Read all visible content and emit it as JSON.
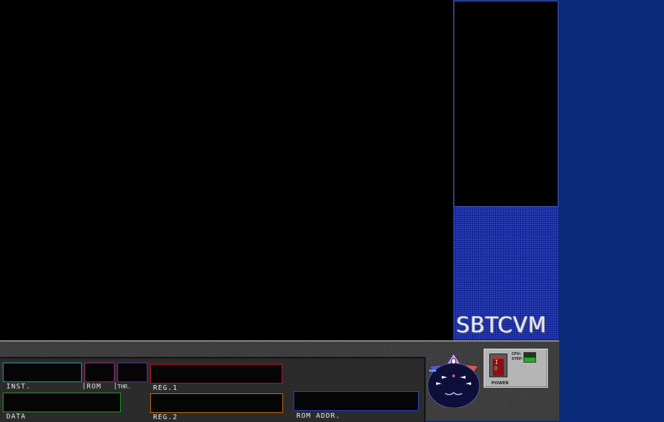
{
  "side_panel": {
    "logo": "SBTCVM"
  },
  "registers": {
    "inst": {
      "label": "INST.",
      "color": "#19a5b3"
    },
    "rom": {
      "label": "ROM",
      "color": "#b01e8c"
    },
    "thr": {
      "label": "THR.",
      "color": "#6a2aa8"
    },
    "reg1": {
      "label": "REG.1",
      "color": "#b8142a"
    },
    "data": {
      "label": "DATA",
      "color": "#1aa51a"
    },
    "reg2": {
      "label": "REG.2",
      "color": "#c8700a"
    },
    "rom_addr": {
      "label": "ROM ADDR.",
      "color": "#2a40c8"
    }
  },
  "power_box": {
    "cpu_label": "CPU:",
    "step_label": "STEP:",
    "power_label": "POWER",
    "switch_on": "I",
    "switch_off": "O"
  },
  "colors": {
    "background": "#0a2a7a",
    "screen": "#000000",
    "side_panel": "#1428a0",
    "cpu_led": "#1b3a1b",
    "step_led": "#22b022"
  }
}
